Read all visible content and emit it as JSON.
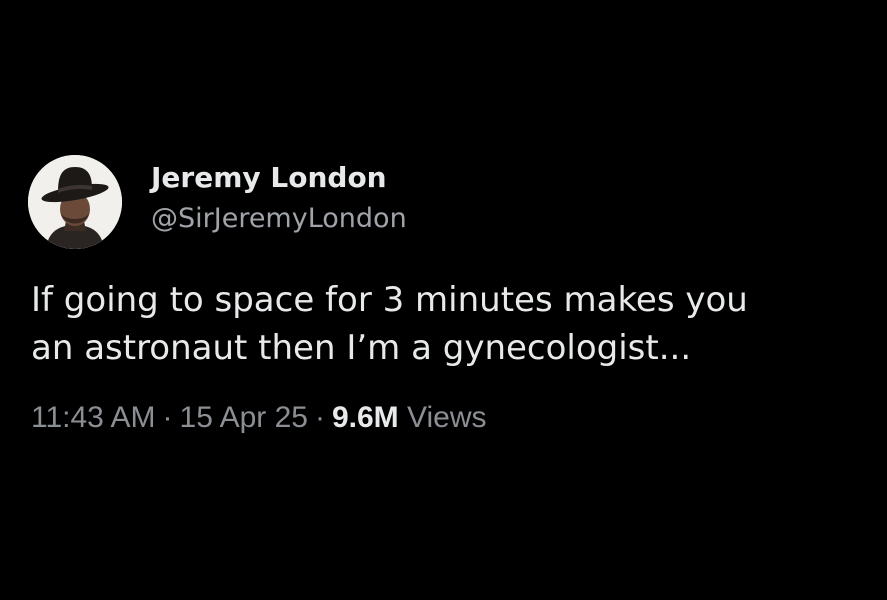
{
  "author": {
    "display_name": "Jeremy London",
    "handle": "@SirJeremyLondon",
    "avatar_icon": "profile-photo-man-in-hat-icon"
  },
  "tweet": {
    "text_lines": [
      "If going to space for 3 minutes makes you",
      "an astronaut then I’m a gynecologist..."
    ]
  },
  "meta": {
    "time": "11:43 AM",
    "separator": "·",
    "date": "15 Apr 25",
    "views_count": "9.6M",
    "views_label": "Views"
  },
  "colors": {
    "background": "#000000",
    "primary_text": "#e7e9ea",
    "secondary_text": "#8b8f93"
  }
}
